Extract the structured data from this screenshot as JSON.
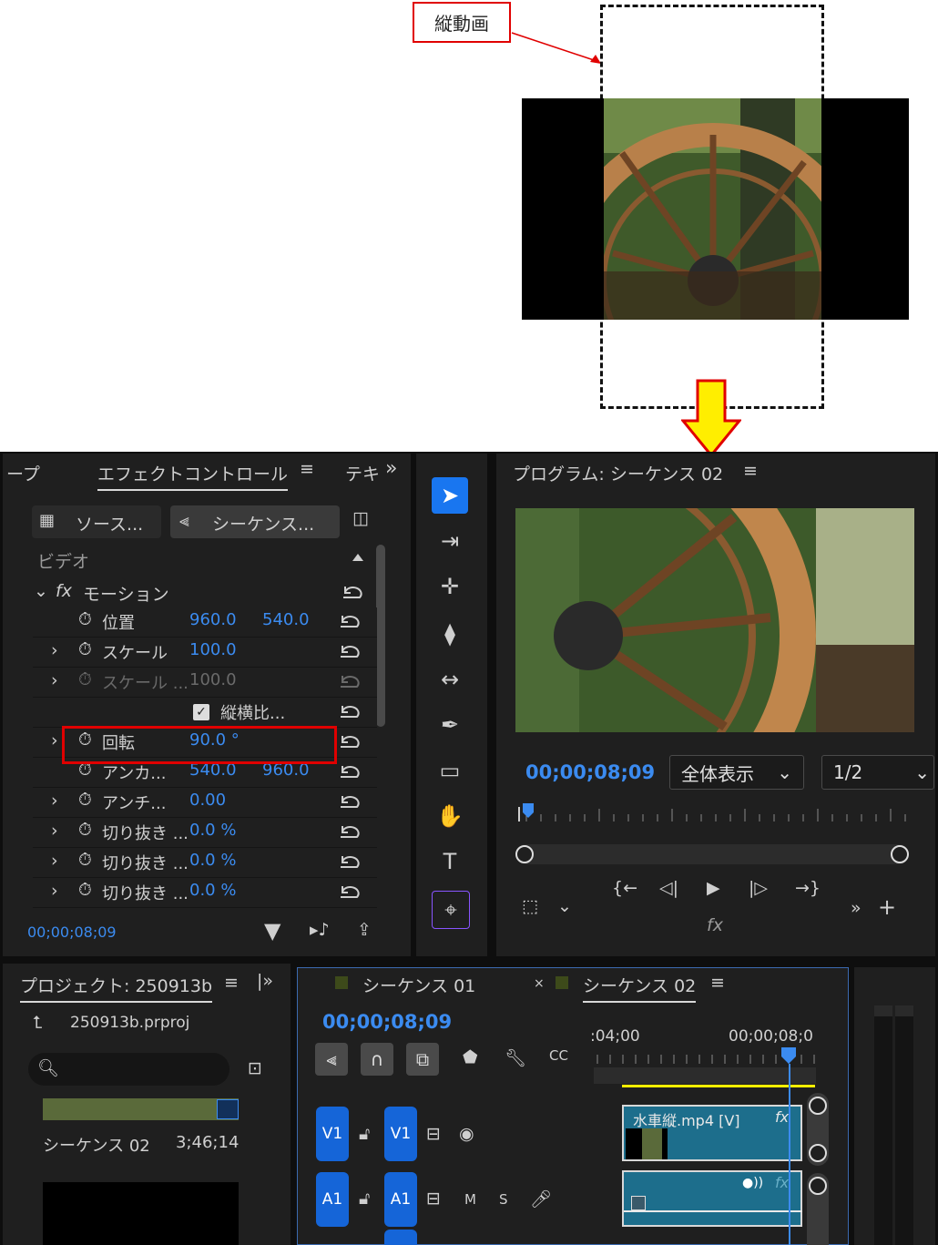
{
  "annotation": {
    "label": "縦動画"
  },
  "effect_controls": {
    "tabs": [
      "ープ",
      "エフェクトコントロール",
      "テキ"
    ],
    "source_tab": "ソース...",
    "sequence_tab": "シーケンス...",
    "section_video": "ビデオ",
    "motion_label": "モーション",
    "rows": [
      {
        "name": "位置",
        "v1": "960.0",
        "v2": "540.0"
      },
      {
        "name": "スケール",
        "v1": "100.0",
        "v2": ""
      },
      {
        "name": "スケール ...",
        "v1": "100.0",
        "v2": ""
      },
      {
        "name": "縦横比...",
        "v1": "",
        "v2": ""
      },
      {
        "name": "回転",
        "v1": "90.0 °",
        "v2": ""
      },
      {
        "name": "アンカ...",
        "v1": "540.0",
        "v2": "960.0"
      },
      {
        "name": "アンチ...",
        "v1": "0.00",
        "v2": ""
      },
      {
        "name": "切り抜き ...",
        "v1": "0.0 %",
        "v2": ""
      },
      {
        "name": "切り抜き ...",
        "v1": "0.0 %",
        "v2": ""
      },
      {
        "name": "切り抜き ...",
        "v1": "0.0 %",
        "v2": ""
      }
    ],
    "timecode": "00;00;08;09"
  },
  "program_monitor": {
    "title": "プログラム: シーケンス 02",
    "timecode": "00;00;08;09",
    "fit_label": "全体表示",
    "resolution": "1/2",
    "fx_label": "fx"
  },
  "project_panel": {
    "title": "プロジェクト: 250913b",
    "file": "250913b.prproj",
    "search_placeholder": "",
    "item_name": "シーケンス 02",
    "item_duration": "3;46;14"
  },
  "timeline": {
    "tab1": "シーケンス 01",
    "tab2": "シーケンス 02",
    "timecode": "00;00;08;09",
    "ruler_left": ":04;00",
    "ruler_right": "00;00;08;0",
    "tracks": {
      "v1_source": "V1",
      "v1_target": "V1",
      "a1_source": "A1",
      "a1_target": "A1",
      "m": "M",
      "s": "S"
    },
    "clip_label": "水車縦.mp4 [V]",
    "clip_fx": "fx"
  },
  "colors": {
    "accent_blue": "#3b8bf0",
    "highlight_red": "#e00000",
    "arrow_yellow": "#ffee00",
    "track_blue": "#1565d8",
    "clip_teal": "#1d6e8c"
  }
}
